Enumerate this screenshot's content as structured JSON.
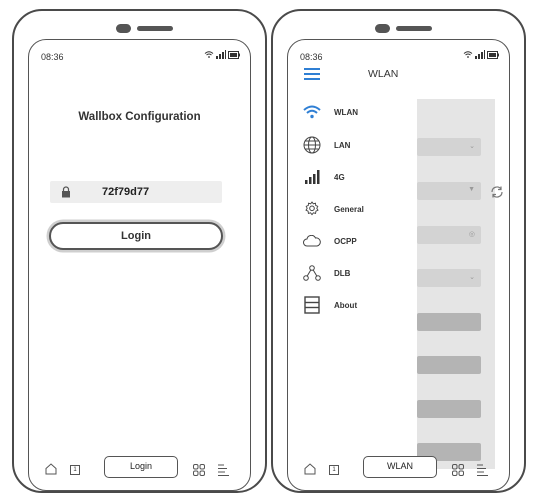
{
  "phone_left": {
    "status": {
      "time": "08:36"
    },
    "title": "Wallbox Configuration",
    "password": {
      "value": "72f79d77"
    },
    "login_button": "Login",
    "bottom_bar": {
      "tab_label": "Login",
      "one_label": "1"
    }
  },
  "phone_right": {
    "status": {
      "time": "08:36"
    },
    "title": "WLAN",
    "menu": [
      {
        "label": "WLAN",
        "icon": "wifi-icon",
        "active": true
      },
      {
        "label": "LAN",
        "icon": "globe-icon"
      },
      {
        "label": "4G",
        "icon": "signal-bars-icon"
      },
      {
        "label": "General",
        "icon": "gear-icon"
      },
      {
        "label": "OCPP",
        "icon": "cloud-icon"
      },
      {
        "label": "DLB",
        "icon": "network-nodes-icon"
      },
      {
        "label": "About",
        "icon": "list-box-icon"
      }
    ],
    "bottom_bar": {
      "tab_label": "WLAN",
      "one_label": "1"
    }
  },
  "colors": {
    "accent": "#2f7fd4",
    "outline": "#4a4a4a",
    "field": "#eeeeee",
    "overlay_gray": "#e5e5e5"
  }
}
